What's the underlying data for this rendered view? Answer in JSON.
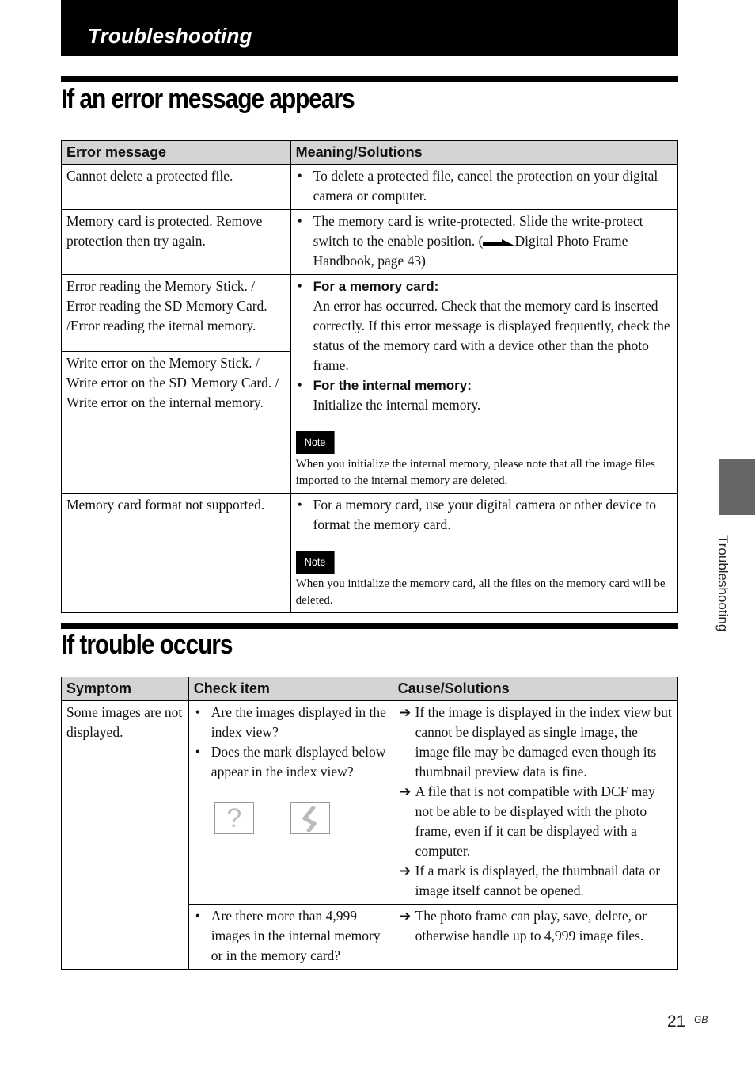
{
  "header": {
    "title": "Troubleshooting"
  },
  "section1": {
    "title": "If an error message appears",
    "columns": [
      "Error message",
      "Meaning/Solutions"
    ],
    "rows": [
      {
        "error": "Cannot delete a protected file.",
        "solution": "To delete a protected file, cancel the protection on your digital camera or computer."
      },
      {
        "error": "Memory card is protected. Remove protection then try again.",
        "solution_before": "The memory card is write-protected. Slide the write-protect switch to the enable position. (",
        "solution_ref": "Digital Photo Frame Handbook, page 43)",
        "ref_icon": "reference-arrow-icon"
      },
      {
        "error_a": "Error reading the Memory Stick.  / Error reading the SD Memory Card. /Error reading the iternal memory.",
        "error_b": "Write error on the  Memory Stick. / Write error on the SD Memory Card. /  Write error on the internal memory.",
        "heading1": "For a memory card:",
        "text1": "An error has occurred.  Check that the memory card is inserted correctly. If this error message is displayed frequently, check the status of the memory card with a device other than the photo frame.",
        "heading2": "For the internal memory:",
        "text2": "Initialize the internal memory.",
        "note_label": "Note",
        "note": "When you initialize the internal memory, please note that all the image files imported to the internal memory are deleted."
      },
      {
        "error": "Memory card format not supported.",
        "solution": "For a memory card, use your digital camera or other device to format the memory card.",
        "note_label": "Note",
        "note": "When you initialize the memory card, all the files on the memory card will be deleted."
      }
    ]
  },
  "section2": {
    "title": "If trouble occurs",
    "columns": [
      "Symptom",
      "Check item",
      "Cause/Solutions"
    ],
    "symptom": "Some images are not displayed.",
    "rows": [
      {
        "checks": [
          "Are the images displayed in the index view?",
          "Does the mark displayed below appear in the index view?"
        ],
        "marks": [
          "?",
          "broken-image"
        ],
        "causes": [
          "If the image is displayed in the index view but cannot be displayed as single image, the image file may be damaged even though its thumbnail preview data is fine.",
          "A file that is not compatible with DCF may not be able to be displayed with the photo frame, even if it can be displayed with a computer.",
          "If a mark is displayed, the thumbnail data or image itself cannot be opened."
        ]
      },
      {
        "checks": [
          "Are there more than 4,999 images in the internal memory or in the memory card?"
        ],
        "causes": [
          "The photo frame can play, save, delete, or otherwise handle up to 4,999 image files."
        ]
      }
    ]
  },
  "bullet": "•",
  "arrow": "➔",
  "side_tab": {
    "label": "Troubleshooting",
    "color": "#666666"
  },
  "footer": {
    "page": "21",
    "suffix": "GB"
  }
}
